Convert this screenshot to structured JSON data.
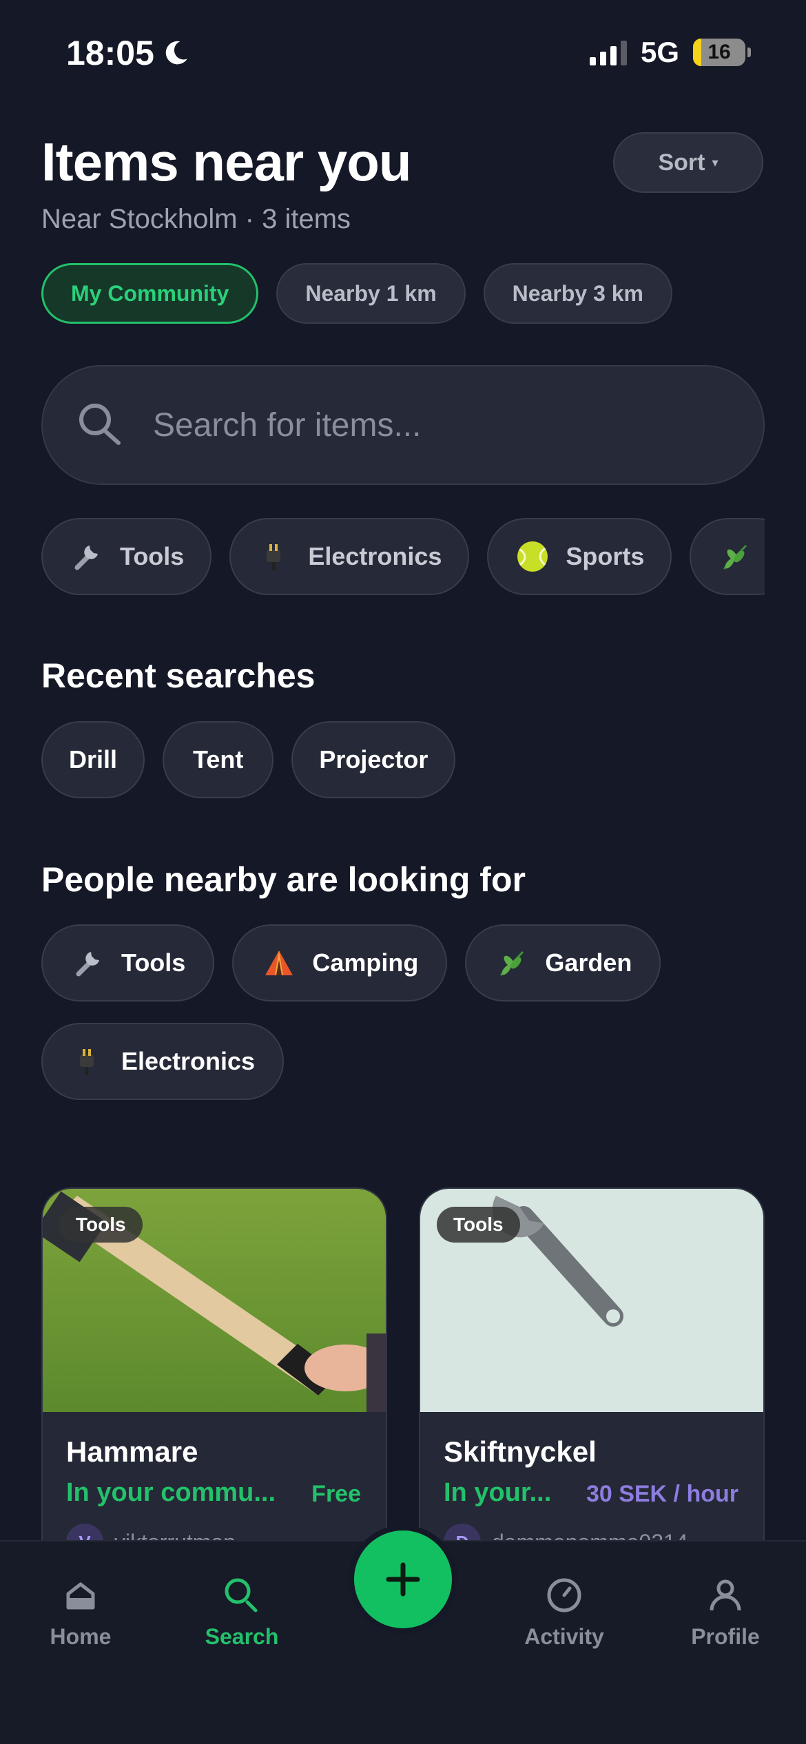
{
  "status_bar": {
    "time": "18:05",
    "network": "5G",
    "battery": "16"
  },
  "header": {
    "title": "Items near you",
    "subtitle": "Near Stockholm · 3 items",
    "sort_label": "Sort",
    "sort_caret": "▾"
  },
  "filters": [
    {
      "label": "My Community",
      "active": true
    },
    {
      "label": "Nearby 1 km",
      "active": false
    },
    {
      "label": "Nearby 3 km",
      "active": false
    }
  ],
  "search": {
    "placeholder": "Search for items..."
  },
  "categories": [
    {
      "label": "Tools",
      "icon": "wrench-icon"
    },
    {
      "label": "Electronics",
      "icon": "plug-icon"
    },
    {
      "label": "Sports",
      "icon": "tennis-ball-icon"
    },
    {
      "label": "",
      "icon": "herb-icon"
    }
  ],
  "recent": {
    "title": "Recent searches",
    "items": [
      "Drill",
      "Tent",
      "Projector"
    ]
  },
  "looking_for": {
    "title": "People nearby are looking for",
    "items": [
      {
        "label": "Tools",
        "icon": "wrench-icon"
      },
      {
        "label": "Camping",
        "icon": "tent-icon"
      },
      {
        "label": "Garden",
        "icon": "herb-icon"
      },
      {
        "label": "Electronics",
        "icon": "plug-icon"
      }
    ]
  },
  "cards": [
    {
      "badge": "Tools",
      "title": "Hammare",
      "subtitle": "In your commu...",
      "price": "Free",
      "price_color": "#23c16b",
      "owner_initial": "V",
      "owner_name": "viktorrutman"
    },
    {
      "badge": "Tools",
      "title": "Skiftnyckel",
      "subtitle": "In your...",
      "price": "30 SEK / hour",
      "price_color": "#8d7de0",
      "owner_initial": "D",
      "owner_name": "dammenomme0214"
    }
  ],
  "tabs": [
    {
      "label": "Home",
      "active": false
    },
    {
      "label": "Search",
      "active": true
    },
    {
      "label": "Activity",
      "active": false
    },
    {
      "label": "Profile",
      "active": false
    }
  ],
  "colors": {
    "accent": "#23c16b",
    "background": "#151826",
    "price_purple": "#8d7de0"
  }
}
